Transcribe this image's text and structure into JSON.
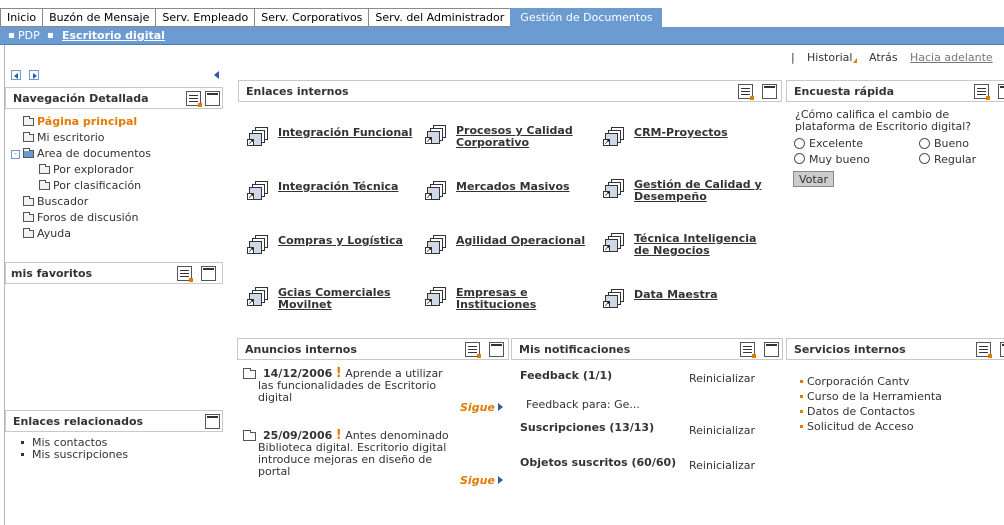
{
  "tabs": [
    {
      "label": "Inicio"
    },
    {
      "label": "Buzón de Mensaje"
    },
    {
      "label": "Serv. Empleado"
    },
    {
      "label": "Serv. Corporativos"
    },
    {
      "label": "Serv. del Administrador"
    },
    {
      "label": "Gestión de Documentos",
      "active": true
    }
  ],
  "subbar": {
    "items": [
      {
        "label": "PDP"
      },
      {
        "label": "Escritorio digital",
        "current": true
      }
    ]
  },
  "history": {
    "separator": "|",
    "historial": "Historial",
    "back": "Atrás",
    "forward": "Hacia adelante"
  },
  "nav": {
    "title": "Navegación Detallada",
    "items": [
      {
        "label": "Página principal"
      },
      {
        "label": "Mi escritorio"
      },
      {
        "label": "Area de documentos"
      },
      {
        "label": "Por explorador"
      },
      {
        "label": "Por clasificación"
      },
      {
        "label": "Buscador"
      },
      {
        "label": "Foros de discusión"
      },
      {
        "label": "Ayuda"
      }
    ]
  },
  "favorites": {
    "title": "mis favoritos"
  },
  "related": {
    "title": "Enlaces relacionados",
    "items": [
      {
        "label": "Mis contactos"
      },
      {
        "label": "Mis suscripciones"
      }
    ]
  },
  "internal_links": {
    "title": "Enlaces internos",
    "items": [
      {
        "label": "Integración Funcional"
      },
      {
        "label": "Procesos y Calidad Corporativo"
      },
      {
        "label": "CRM-Proyectos"
      },
      {
        "label": "Integración Técnica"
      },
      {
        "label": "Mercados Masivos"
      },
      {
        "label": "Gestión de Calidad y Desempeño"
      },
      {
        "label": "Compras y Logística"
      },
      {
        "label": "Agilidad Operacional"
      },
      {
        "label": "Técnica Inteligencia de Negocios"
      },
      {
        "label": "Gcias Comerciales Movilnet"
      },
      {
        "label": "Empresas e Instituciones"
      },
      {
        "label": "Data Maestra"
      }
    ]
  },
  "poll": {
    "title": "Encuesta rápida",
    "question": "¿Cómo califica el cambio de plataforma de Escritorio digital?",
    "options": [
      {
        "label": "Excelente"
      },
      {
        "label": "Bueno"
      },
      {
        "label": "Muy bueno"
      },
      {
        "label": "Regular"
      }
    ],
    "vote_label": "Votar"
  },
  "announcements": {
    "title": "Anuncios internos",
    "items": [
      {
        "date": "14/12/2006",
        "bang": "!",
        "text": "Aprende a utilizar las funcionalidades de Escritorio digital",
        "more": "Sigue"
      },
      {
        "date": "25/09/2006",
        "bang": "!",
        "text": "Antes denominado Biblioteca digital. Escritorio digital introduce mejoras en diseño de portal",
        "more": "Sigue"
      }
    ]
  },
  "notifications": {
    "title": "Mis notificaciones",
    "items": [
      {
        "label": "Feedback (1/1)",
        "action": "Reinicializar",
        "sub": "Feedback para: Ge..."
      },
      {
        "label": "Suscripciones (13/13)",
        "action": "Reinicializar"
      },
      {
        "label": "Objetos suscritos (60/60)",
        "action": "Reinicializar"
      }
    ]
  },
  "services": {
    "title": "Servicios internos",
    "items": [
      {
        "label": "Corporación Cantv"
      },
      {
        "label": "Curso de la Herramienta"
      },
      {
        "label": "Datos de Contactos"
      },
      {
        "label": "Solicitud de Acceso"
      }
    ]
  },
  "colors": {
    "accent": "#6b9bd1",
    "highlight": "#e07b00",
    "border": "#c9c9c9"
  }
}
